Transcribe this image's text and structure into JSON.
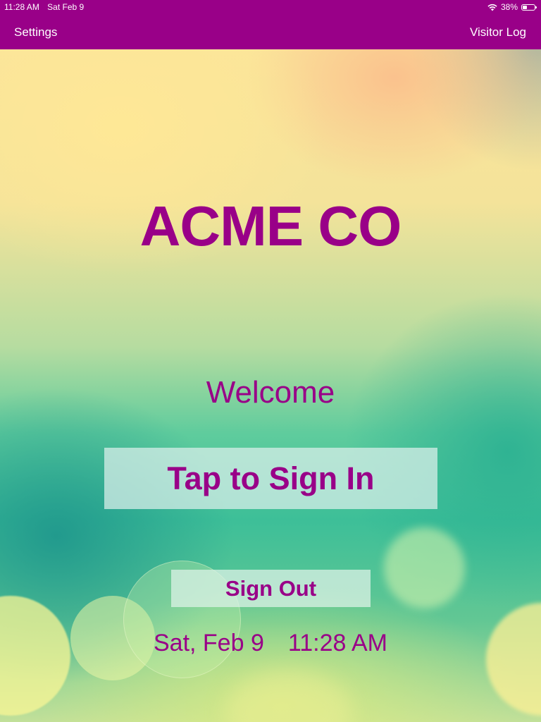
{
  "status_bar": {
    "time": "11:28 AM",
    "date": "Sat Feb 9",
    "battery_percent": "38%",
    "battery_level": 0.38
  },
  "nav": {
    "left_label": "Settings",
    "right_label": "Visitor Log"
  },
  "main": {
    "company_name": "ACME CO",
    "welcome_text": "Welcome",
    "sign_in_label": "Tap to Sign In",
    "sign_out_label": "Sign Out",
    "date": "Sat, Feb 9",
    "time": "11:28 AM"
  },
  "colors": {
    "brand": "#990088",
    "button_bg": "#dcf0eb"
  },
  "icons": [
    "wifi-icon",
    "battery-icon"
  ]
}
